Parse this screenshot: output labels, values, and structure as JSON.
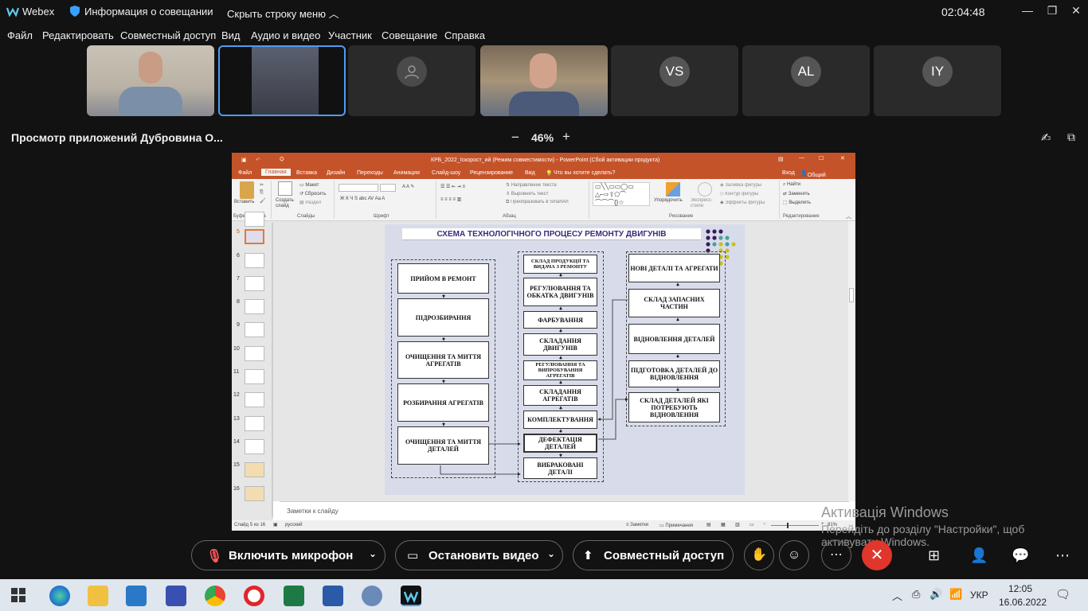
{
  "topbar": {
    "app": "Webex",
    "meeting_info": "Информация о совещании",
    "hide_menu": "Скрыть строку меню",
    "clock": "02:04:48"
  },
  "menu": [
    "Файл",
    "Редактировать",
    "Совместный доступ",
    "Вид",
    "Аудио и видео",
    "Участник",
    "Совещание",
    "Справка"
  ],
  "participants": [
    {
      "type": "video"
    },
    {
      "type": "video"
    },
    {
      "type": "avatar",
      "initials": ""
    },
    {
      "type": "video"
    },
    {
      "type": "avatar",
      "initials": "VS"
    },
    {
      "type": "avatar",
      "initials": "AL"
    },
    {
      "type": "avatar",
      "initials": "IY"
    }
  ],
  "share": {
    "title": "Просмотр приложений Дубровина О...",
    "zoom_minus": "−",
    "zoom": "46%",
    "zoom_plus": "+"
  },
  "ppt": {
    "title": "КРБ_2022_Іскорост_ий (Режим совместимости) - PowerPoint (Сбой активации продукта)",
    "sign_in": "Вход",
    "share_btn": "Общий доступ",
    "tabs": [
      "Файл",
      "Главная",
      "Вставка",
      "Дизайн",
      "Переходы",
      "Анимация",
      "Слайд-шоу",
      "Рецензирование",
      "Вид"
    ],
    "tell_me": "Что вы хотите сделать?",
    "ribbon": {
      "paste": "Вставить",
      "create_slide": "Создать слайд",
      "layout": "Макет",
      "reset": "Сбросить",
      "section": "Раздел",
      "text_dir": "Направление текста",
      "align_text": "Выровнять текст",
      "smartart": "Преобразовать в SmartArt",
      "arrange": "Упорядочить",
      "quick_styles": "Экспресс-стили",
      "fill": "Заливка фигуры",
      "outline": "Контур фигуры",
      "effects": "Эффекты фигуры",
      "find": "Найти",
      "replace": "Заменить",
      "select": "Выделить",
      "groups": {
        "clipboard": "Буфер обмена",
        "slides": "Слайды",
        "font": "Шрифт",
        "paragraph": "Абзац",
        "drawing": "Рисование",
        "editing": "Редактирование"
      }
    },
    "slide_numbers": [
      "5",
      "6",
      "7",
      "8",
      "9",
      "10",
      "11",
      "12",
      "13",
      "14",
      "15",
      "16"
    ],
    "notes": "Заметки к слайду",
    "status": {
      "slide": "Слайд 5 из 16",
      "lang": "русский",
      "notes": "Заметки",
      "comments": "Примечания",
      "zoom": "81%"
    },
    "slide": {
      "title": "СХЕМА ТЕХНОЛОГІЧНОГО ПРОЦЕСУ РЕМОНТУ ДВИГУНІВ",
      "col1": [
        "ПРИЙОМ В РЕМОНТ",
        "ПІДРОЗБИРАННЯ",
        "ОЧИЩЕННЯ ТА МИТТЯ АГРЕГАТІВ",
        "РОЗБИРАННЯ АГРЕГАТІВ",
        "ОЧИЩЕННЯ ТА МИТТЯ ДЕТАЛЕЙ"
      ],
      "col2": [
        "СКЛАД ПРОДУКЦІЇ ТА ВИДАЧА З РЕМОНТУ",
        "РЕГУЛЮВАННЯ ТА ОБКАТКА ДВИГУНІВ",
        "ФАРБУВАННЯ",
        "СКЛАДАННЯ ДВИГУНІВ",
        "РЕГУЛЮВАННЯ ТА ВИПРОБУВАННЯ АГРЕГАТІВ",
        "СКЛАДАННЯ АГРЕГАТІВ",
        "КОМПЛЕКТУВАННЯ",
        "ДЕФЕКТАЦІЯ ДЕТАЛЕЙ",
        "ВИБРАКОВАНІ ДЕТАЛІ"
      ],
      "col3": [
        "НОВІ ДЕТАЛІ ТА АГРЕГАТИ",
        "СКЛАД ЗАПАСНИХ ЧАСТИН",
        "ВІДНОВЛЕННЯ ДЕТАЛЕЙ",
        "ПІДГОТОВКА ДЕТАЛЕЙ ДО ВІДНОВЛЕННЯ",
        "СКЛАД ДЕТАЛЕЙ ЯКІ ПОТРЕБУЮТЬ ВІДНОВЛЕННЯ"
      ]
    }
  },
  "watermark": {
    "line1": "Активація Windows",
    "line2": "Перейдіть до розділу \"Настройки\", щоб",
    "line3": "активувати Windows."
  },
  "controls": {
    "mic": "Включить микрофон",
    "video": "Остановить видео",
    "share": "Совместный доступ"
  },
  "taskbar": {
    "lang": "УКР",
    "time": "12:05",
    "date": "16.06.2022"
  }
}
